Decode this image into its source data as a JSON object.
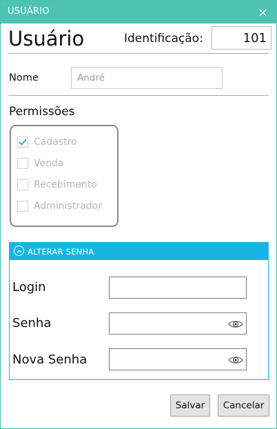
{
  "window": {
    "title": "USUÁRIO"
  },
  "header": {
    "title": "Usuário",
    "id_label": "Identificação:",
    "id_value": "101"
  },
  "name": {
    "label": "Nome",
    "value": "André"
  },
  "permissions": {
    "title": "Permissões",
    "items": [
      {
        "label": "Cadastro",
        "checked": true
      },
      {
        "label": "Venda",
        "checked": false
      },
      {
        "label": "Recebimento",
        "checked": false
      },
      {
        "label": "Administrador",
        "checked": false
      }
    ]
  },
  "password_section": {
    "header": "ALTERAR SENHA",
    "expanded": true,
    "fields": [
      {
        "label": "Login",
        "value": ""
      },
      {
        "label": "Senha",
        "value": ""
      },
      {
        "label": "Nova Senha",
        "value": ""
      }
    ]
  },
  "buttons": {
    "save": "Salvar",
    "cancel": "Cancelar"
  },
  "colors": {
    "titlebar": "#4ec3b4",
    "expander_header": "#17b5e6",
    "checkmark": "#3aa8d8"
  }
}
